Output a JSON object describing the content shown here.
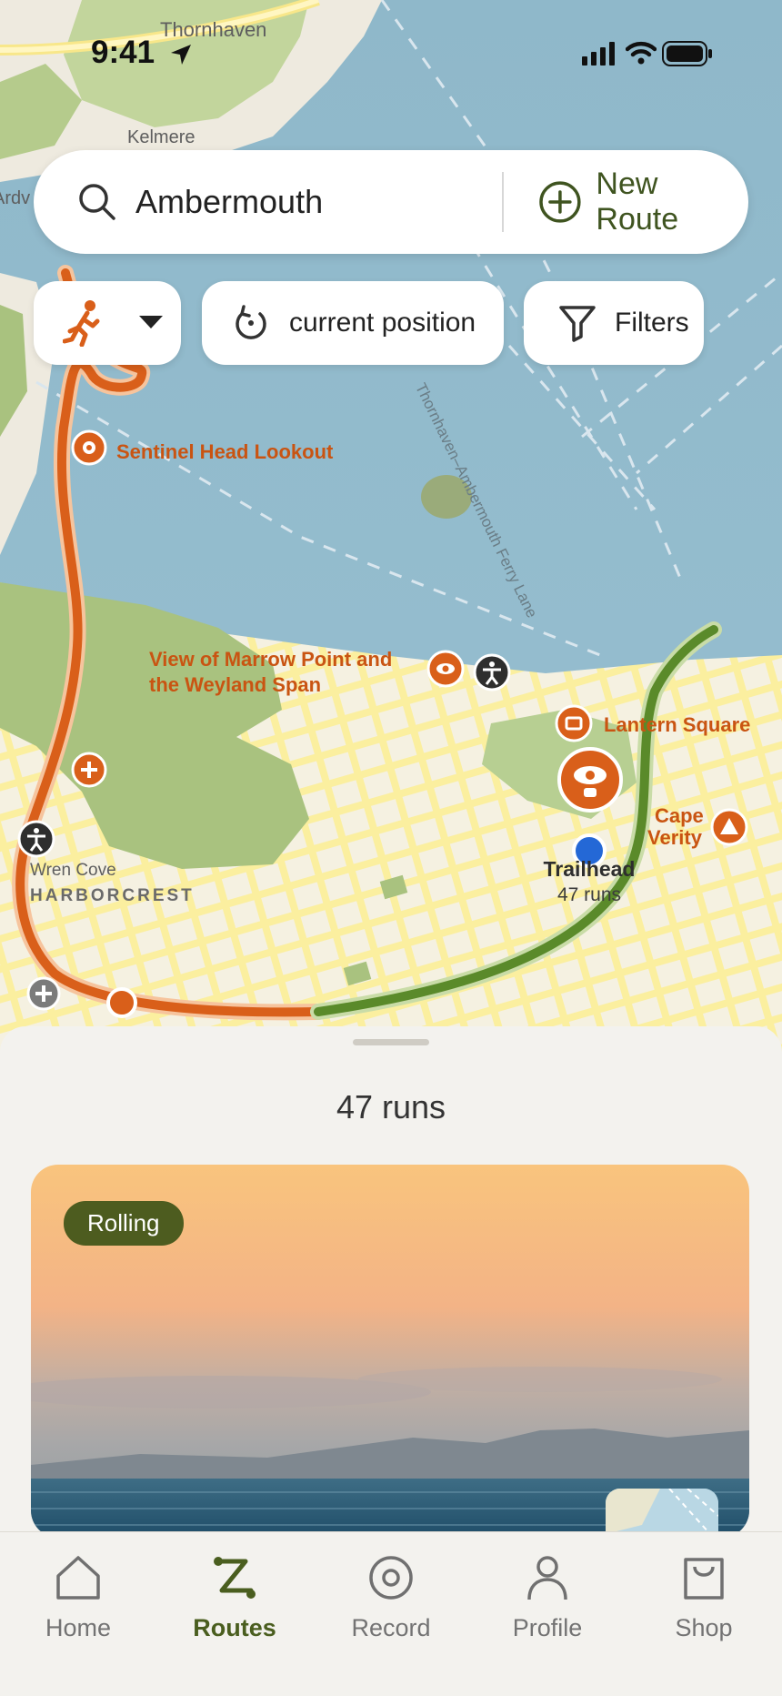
{
  "status_bar": {
    "time": "9:41"
  },
  "search": {
    "value": "Ambermouth",
    "new_route_label": "New Route"
  },
  "chips": {
    "mode_icon": "runner-icon",
    "position_label": "current position",
    "filters_label": "Filters"
  },
  "map": {
    "places": {
      "thornhaven": "Thornhaven",
      "kelmere": "Kelmere",
      "ardv": "Ardv",
      "wren_cove": "Wren Cove",
      "harborcrest": "HARBORCREST",
      "cape_verity_1": "Cape",
      "cape_verity_2": "Verity"
    },
    "road": "Thornhaven–Ambermouth Ferry Lane",
    "pois": {
      "sentinel": "Sentinel Head Lookout",
      "view_line1": "View of Marrow Point and",
      "view_line2": "the Weyland Span",
      "lantern": "Lantern Square"
    },
    "trailhead": {
      "name": "Trailhead",
      "runs": "47 runs"
    },
    "colors": {
      "route_orange": "#d95f1a",
      "route_green": "#5a8a2a",
      "water": "#90b9cb",
      "park": "#a9c27f",
      "urban": "#f7eeb6"
    }
  },
  "sheet": {
    "title": "47 runs",
    "card": {
      "tag": "Rolling"
    }
  },
  "tabs": [
    {
      "label": "Home",
      "icon": "home-icon"
    },
    {
      "label": "Routes",
      "icon": "routes-icon",
      "active": true
    },
    {
      "label": "Record",
      "icon": "record-icon"
    },
    {
      "label": "Profile",
      "icon": "profile-icon"
    },
    {
      "label": "Shop",
      "icon": "shop-icon"
    }
  ]
}
